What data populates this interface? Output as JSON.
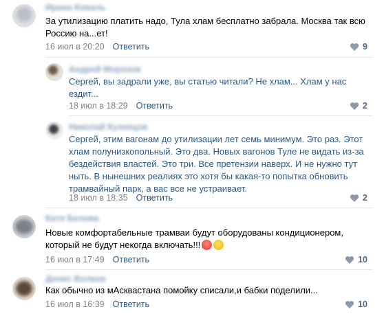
{
  "comments": [
    {
      "author": "Ирина Коваль",
      "text": "За утилизацию платить надо, Тула хлам бесплатно забрала. Москва так всю Россию на...ет!",
      "date": "16 июл в 20:20",
      "reply": "Ответить",
      "likes": "9"
    },
    {
      "author": "Андрей Морозов",
      "addressee": "Сергей",
      "text": ", вы задрали уже, вы статью читали? Не хлам... Хлам у нас ездит...",
      "date": "18 июл в 18:29",
      "reply": "Ответить",
      "likes": "2"
    },
    {
      "author": "Николай Кузнецов",
      "addressee": "Сергей",
      "text": ", этим вагонам до утилизации лет семь минимум. Это раз. Этот хлам полунизкопольный. Это два. Новых вагонов Туле не видать из-за бездействия властей. Это три. Все претензии наверх. И не нужно тут ныть. В нынешних реалиях это хотя бы какая-то попытка обновить трамвайный парк, а вас все не устраивает.",
      "date": "18 июл в 18:35",
      "reply": "Ответить",
      "likes": "2"
    },
    {
      "author": "Катя Белова",
      "text": "Новые комфортабельные трамваи будут оборудованы кондиционером, который не будут некогда включать!!!",
      "date": "16 июл в 17:49",
      "reply": "Ответить",
      "likes": "10"
    },
    {
      "author": "Денис Волков",
      "text": "Как обычно из мАсквастана помойку списали,и бабки поделили...",
      "date": "16 июл в 16:39",
      "reply": "Ответить",
      "likes": "10"
    }
  ],
  "icons": {
    "like": "heart-icon",
    "emoji_1": "angry-face-emoji",
    "emoji_2": "laughing-face-emoji"
  },
  "colors": {
    "link": "#2a5885",
    "meta": "#828282",
    "separator": "#e7e8ec"
  }
}
